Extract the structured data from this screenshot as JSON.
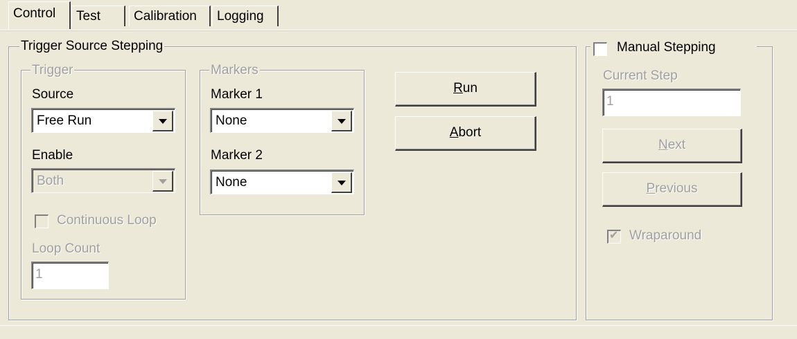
{
  "tabs": [
    "Control",
    "Test",
    "Calibration",
    "Logging"
  ],
  "trigger_source_stepping": {
    "title": "Trigger Source Stepping",
    "trigger": {
      "title": "Trigger",
      "source_label": "Source",
      "source_value": "Free Run",
      "enable_label": "Enable",
      "enable_value": "Both",
      "continuous_loop_label": "Continuous Loop",
      "continuous_loop_checked": false,
      "loop_count_label": "Loop Count",
      "loop_count_value": "1"
    },
    "markers": {
      "title": "Markers",
      "marker1_label": "Marker 1",
      "marker1_value": "None",
      "marker2_label": "Marker 2",
      "marker2_value": "None"
    },
    "run_label_accel": "R",
    "run_label_rest": "un",
    "abort_label_accel": "A",
    "abort_label_rest": "bort"
  },
  "manual_stepping": {
    "title": "Manual Stepping",
    "checked": false,
    "current_step_label": "Current Step",
    "current_step_value": "1",
    "next_label_accel": "N",
    "next_label_rest": "ext",
    "previous_label_accel": "P",
    "previous_label_rest": "revious",
    "wraparound_label": "Wraparound",
    "wraparound_checked": true
  }
}
